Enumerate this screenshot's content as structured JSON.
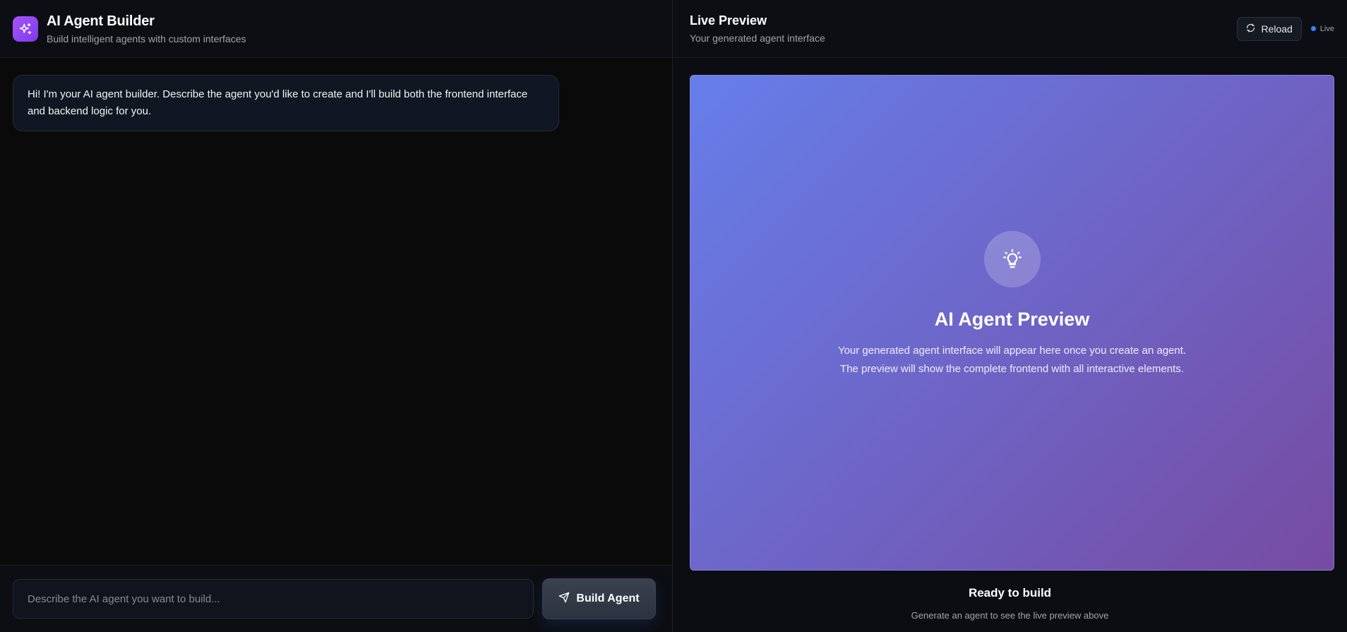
{
  "builder": {
    "title": "AI Agent Builder",
    "subtitle": "Build intelligent agents with custom interfaces",
    "logo_icon": "sparkles-icon",
    "accent": "#a855f7"
  },
  "chat": {
    "messages": [
      {
        "role": "assistant",
        "text": "Hi! I'm your AI agent builder. Describe the agent you'd like to create and I'll build both the frontend interface and backend logic for you."
      }
    ]
  },
  "composer": {
    "placeholder": "Describe the AI agent you want to build...",
    "value": "",
    "build_label": "Build Agent",
    "build_icon": "send-icon"
  },
  "preview_panel": {
    "title": "Live Preview",
    "subtitle": "Your generated agent interface",
    "reload_label": "Reload",
    "reload_icon": "refresh-icon",
    "live_label": "Live",
    "live_color": "#3b82f6"
  },
  "preview": {
    "icon": "lightbulb-icon",
    "title": "AI Agent Preview",
    "description": "Your generated agent interface will appear here once you create an agent. The preview will show the complete frontend with all interactive elements.",
    "gradient_start": "#667eea",
    "gradient_end": "#764ba2"
  },
  "status": {
    "title": "Ready to build",
    "subtitle": "Generate an agent to see the live preview above"
  }
}
